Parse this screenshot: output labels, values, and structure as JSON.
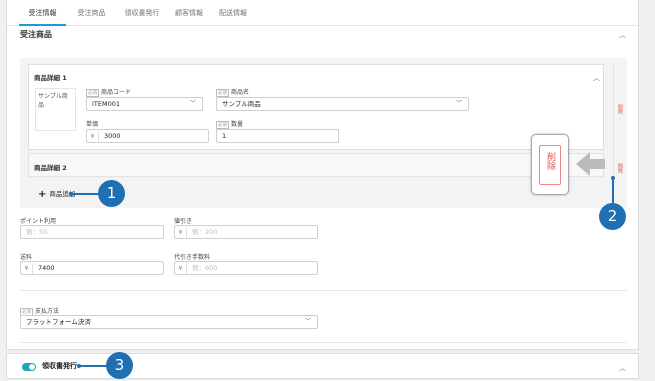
{
  "tabs": [
    "受注情報",
    "受注商品",
    "領収書発行",
    "顧客情報",
    "配送情報"
  ],
  "section_title": "受注商品",
  "product1": {
    "title": "商品詳細 1",
    "image_alt": "サンプル商品",
    "required_badge": "必須",
    "code_label": "商品コード",
    "code_value": "ITEM001",
    "name_label": "商品名",
    "name_value": "サンプル商品",
    "price_label": "単価",
    "price_value": "3000",
    "qty_label": "数量",
    "qty_value": "1"
  },
  "product2": {
    "title": "商品詳細 2"
  },
  "delete_label": "削除",
  "add_product_label": "商品追加",
  "points": {
    "label": "ポイント利用",
    "placeholder": "例：50"
  },
  "discount": {
    "label": "値引き",
    "placeholder": "例：200"
  },
  "shipping": {
    "label": "送料",
    "value": "7400"
  },
  "cod_fee": {
    "label": "代引き手数料",
    "placeholder": "例：600"
  },
  "currency": "¥",
  "payment": {
    "label": "支払方法",
    "value": "プラットフォーム決済"
  },
  "receipt": {
    "label": "領収書発行",
    "toggle_on": true
  },
  "callouts": [
    "1",
    "2",
    "3"
  ],
  "colors": {
    "accent": "#1a9bd7",
    "callout": "#1f6fb2",
    "delete": "#e05050",
    "toggle": "#1aa7b8"
  }
}
